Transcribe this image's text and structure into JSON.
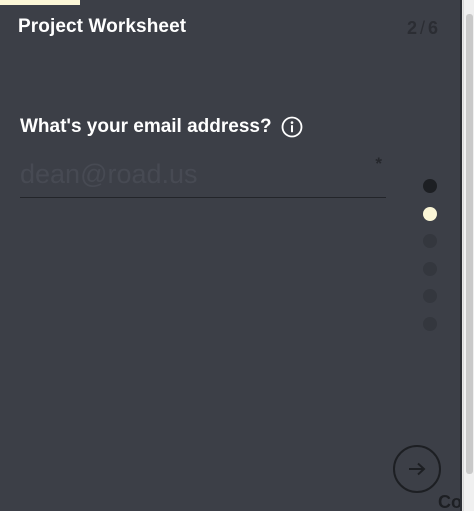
{
  "header": {
    "title": "Project Worksheet",
    "step_current": "2",
    "step_separator": "/",
    "step_total": "6"
  },
  "question": {
    "label": "What's your email address?",
    "info_icon": "info-circle-icon"
  },
  "email_field": {
    "value": "",
    "placeholder": "dean@road.us",
    "required_marker": "*"
  },
  "progress": {
    "steps": 6,
    "current_step": 2,
    "fraction_complete": 0.1667
  },
  "navigation": {
    "next_icon": "arrow-right-icon",
    "cutoff_text": "Co"
  },
  "colors": {
    "background": "#3c3f47",
    "accent": "#fbf6d7",
    "text": "#ffffff",
    "muted": "#1d1f23"
  }
}
